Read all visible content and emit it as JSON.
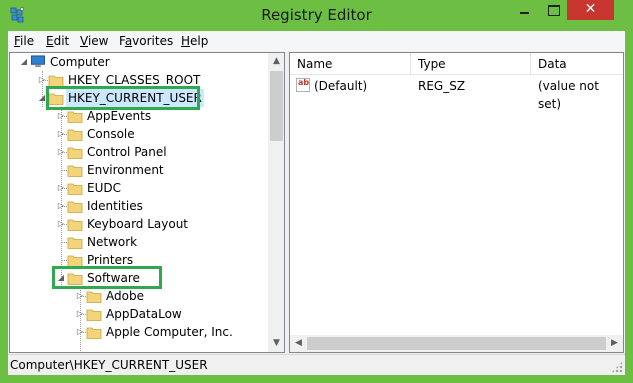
{
  "window": {
    "title": "Registry Editor",
    "close_glyph": "✕",
    "colors": {
      "frame": "#6cbf43",
      "close": "#c7372f",
      "highlight_box": "#2fa84f",
      "selection": "#cce8ff"
    }
  },
  "menu": {
    "items": [
      {
        "accel": "F",
        "rest": "ile"
      },
      {
        "accel": "E",
        "rest": "dit"
      },
      {
        "accel": "V",
        "rest": "iew"
      },
      {
        "pre": "F",
        "accel": "a",
        "rest": "vorites"
      },
      {
        "accel": "H",
        "rest": "elp"
      }
    ]
  },
  "tree": {
    "root": "Computer",
    "hkcr": "HKEY_CLASSES_ROOT",
    "hkcu": "HKEY_CURRENT_USER",
    "hkcu_children": [
      "AppEvents",
      "Console",
      "Control Panel",
      "Environment",
      "EUDC",
      "Identities",
      "Keyboard Layout",
      "Network",
      "Printers",
      "Software"
    ],
    "software_children": [
      "Adobe",
      "AppDataLow",
      "Apple Computer, Inc."
    ]
  },
  "list": {
    "columns": [
      "Name",
      "Type",
      "Data"
    ],
    "rows": [
      {
        "name": "(Default)",
        "type": "REG_SZ",
        "data": "(value not set)",
        "icon": "ab"
      }
    ]
  },
  "status": {
    "path": "Computer\\HKEY_CURRENT_USER"
  }
}
